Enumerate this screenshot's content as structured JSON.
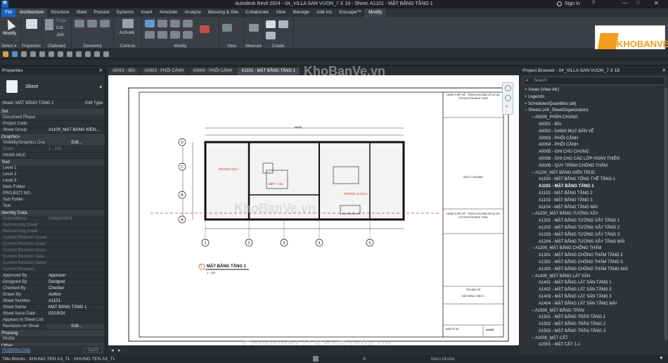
{
  "app": {
    "title": "Autodesk Revit 2024 - 04_VILLA SAN VUON_7 X 18 - Sheet: A1101 - MẶT BẰNG TẦNG 1",
    "user": "Sign In"
  },
  "ribbon_tabs": [
    "File",
    "Architecture",
    "Structure",
    "Steel",
    "Precast",
    "Systems",
    "Insert",
    "Annotate",
    "Analyze",
    "Massing & Site",
    "Collaborate",
    "View",
    "Manage",
    "Add-Ins",
    "Enscape™",
    "Modify"
  ],
  "ribbon": {
    "modify": "Modify",
    "select": "Select ▾",
    "properties": "Properties",
    "clipboard": "Clipboard",
    "cope": "Cope",
    "cut": "Cut",
    "join": "Join",
    "geometry": "Geometry",
    "activate": "Activate",
    "controls": "Controls",
    "modify_grp": "Modify",
    "view": "View",
    "measure": "Measure",
    "create": "Create"
  },
  "properties": {
    "header": "Properties",
    "type_name": "Sheet",
    "type_selector": "Sheet: MẶT BẰNG TẦNG 1",
    "edit_type": "Edit Type",
    "help": "Properties help",
    "apply": "Apply",
    "sections": [
      {
        "name": "Set",
        "rows": [
          [
            "Document Phase",
            ""
          ],
          [
            "Project Code",
            ""
          ],
          [
            "Sheet Group",
            "A1100_MẶT BẰNG KIẾN..."
          ]
        ]
      },
      {
        "name": "Graphics",
        "rows": [
          [
            "Visibility/Graphics Ove...",
            "Edit..."
          ],
          [
            "Scale",
            "1 : 100"
          ],
          [
            "HẠNG MỤC",
            ""
          ]
        ]
      },
      {
        "name": "Text",
        "rows": [
          [
            "Level 1",
            ""
          ],
          [
            "Level 2",
            ""
          ],
          [
            "Level 3",
            ""
          ],
          [
            "Main Folder",
            ""
          ],
          [
            "PROJECT NO.",
            ""
          ],
          [
            "Sub Folder",
            ""
          ],
          [
            "Text",
            ""
          ]
        ]
      },
      {
        "name": "Identity Data",
        "rows": [
          [
            "Dependency",
            "Independent"
          ],
          [
            "Referencing Sheet",
            ""
          ],
          [
            "Referencing Detail",
            ""
          ],
          [
            "Current Revision Issued",
            ""
          ],
          [
            "Current Revision Issue...",
            ""
          ],
          [
            "Current Revision Issue...",
            ""
          ],
          [
            "Current Revision Date",
            ""
          ],
          [
            "Current Revision Descr...",
            ""
          ],
          [
            "Current Revision",
            ""
          ],
          [
            "Approved By",
            "Approver"
          ],
          [
            "Designed By",
            "Designer"
          ],
          [
            "Checked By",
            "Checker"
          ],
          [
            "Drawn By",
            "Author"
          ],
          [
            "Sheet Number",
            "A1101"
          ],
          [
            "Sheet Name",
            "MẶT BẰNG TẦNG 1"
          ],
          [
            "Sheet Issue Date",
            "02/19/24"
          ],
          [
            "Appears In Sheet List",
            ""
          ],
          [
            "Revisions on Sheet",
            "Edit..."
          ]
        ]
      },
      {
        "name": "Phasing",
        "rows": [
          [
            "PHẦN",
            ""
          ]
        ]
      },
      {
        "name": "Other",
        "rows": []
      }
    ]
  },
  "view_tabs": [
    "A0001 - BÌA",
    "A0003 - PHỐI CẢNH",
    "A0004 - PHỐI CẢNH",
    "A1101 - MẶT BẰNG TẦNG 1"
  ],
  "sheet": {
    "view_title": "MẶT BẰNG TẦNG 1",
    "view_scale": "1 : 100",
    "view_number": "1",
    "dim_total": "14000",
    "rooms": [
      "PHÒNG NGỦ",
      "BẾP + ĂN",
      "PHÒNG KHÁCH"
    ],
    "title_block": [
      "NHẬN THIẾT KẾ - TRIỂN KHAI BẢN VẼ DỰ ÁN",
      "VÕ NGUYỄN MINH TOÀN",
      "NHÀ Ở GIA ĐÌNH",
      "TÊN BẢN VẼ",
      "MẶT BẰNG TẦNG 1",
      "BẢN VẼ SỐ",
      "A1101"
    ],
    "grid_cols": [
      "1",
      "2",
      "3",
      "4",
      "5"
    ],
    "grid_rows": [
      "A",
      "B",
      "C",
      "D"
    ]
  },
  "project_browser": {
    "header": "Project Browser - 04_VILLA SAN VUON_7 X 18",
    "search": "Search",
    "items": [
      [
        "Views (View AK)",
        0
      ],
      [
        "Legends",
        0
      ],
      [
        "Schedules/Quantities (all)",
        0
      ],
      [
        "Sheets (AK_SheetOrganization)",
        0
      ],
      [
        "A0000_PHẦN CHUNG",
        1
      ],
      [
        "A0001 - BÌA",
        2
      ],
      [
        "A0002 - DANH MỤC BẢN VẼ",
        2
      ],
      [
        "A0003 - PHỐI CẢNH",
        2
      ],
      [
        "A0004 - PHỐI CẢNH",
        2
      ],
      [
        "A0005 - GHI CHÚ CHUNG",
        2
      ],
      [
        "A0008 - GHI CHÚ CÁC LỚP HOÀN THIỆN",
        2
      ],
      [
        "A0009 - QUY TRÌNH CHỐNG THẤM",
        2
      ],
      [
        "A1100_MẶT BẰNG KIẾN TRÚC",
        1
      ],
      [
        "A1100 - MẶT BẰNG TỔNG THỂ TẦNG 1",
        2
      ],
      [
        "A1101 - MẶT BẰNG TẦNG 1",
        2
      ],
      [
        "A1102 - MẶT BẰNG TẦNG 2",
        2
      ],
      [
        "A1103 - MẶT BẰNG TẦNG 3",
        2
      ],
      [
        "A1104 - MẶT BẰNG TẦNG MÁI",
        2
      ],
      [
        "A1200_MẶT BẰNG TƯỜNG XÂY",
        1
      ],
      [
        "A1201 - MẶT BẰNG TƯỜNG XÂY TẦNG 1",
        2
      ],
      [
        "A1202 - MẶT BẰNG TƯỜNG XÂY TẦNG 2",
        2
      ],
      [
        "A1203 - MẶT BẰNG TƯỜNG XÂY TẦNG 3",
        2
      ],
      [
        "A1204 - MẶT BẰNG TƯỜNG XÂY TẦNG MÁI",
        2
      ],
      [
        "A1300_MẶT BẰNG CHỐNG THẤM",
        1
      ],
      [
        "A1301 - MẶT BẰNG CHỐNG THẤM TẦNG 2",
        2
      ],
      [
        "A1302 - MẶT BẰNG CHỐNG THẤM TẦNG 3",
        2
      ],
      [
        "A1303 - MẶT BẰNG CHỐNG THẤM TẦNG MÁI",
        2
      ],
      [
        "A1400_MẶT BẰNG LÁT SÀN",
        1
      ],
      [
        "A1401 - MẶT BẰNG LÁT SÀN TẦNG 1",
        2
      ],
      [
        "A1402 - MẶT BẰNG LÁT SÀN TẦNG 2",
        2
      ],
      [
        "A1403 - MẶT BẰNG LÁT SÀN TẦNG 3",
        2
      ],
      [
        "A1404 - MẶT BẰNG LÁT SÀN TẦNG MÁI",
        2
      ],
      [
        "A1500_MẶT BẰNG TRẦN",
        1
      ],
      [
        "A1501 - MẶT BẰNG TRẦN TẦNG 1",
        2
      ],
      [
        "A1502 - MẶT BẰNG TRẦN TẦNG 2",
        2
      ],
      [
        "A1503 - MẶT BẰNG TRẦN TẦNG 3",
        2
      ],
      [
        "A2000_MẶT CẮT",
        1
      ],
      [
        "A2001 - MẶT CẮT 1-1",
        2
      ]
    ]
  },
  "status": {
    "left": "Title Blocks : KHUNG TEN A3_TL : KHUNG TEN A3_TL",
    "model": "Main Model",
    "zero": ":0"
  },
  "watermarks": {
    "top": "KhoBanVe.vn",
    "mid": "KhoBanVe.vn",
    "bottom": "Copyright © KhoBanVe.vn",
    "logo": "KHOBANVE"
  }
}
